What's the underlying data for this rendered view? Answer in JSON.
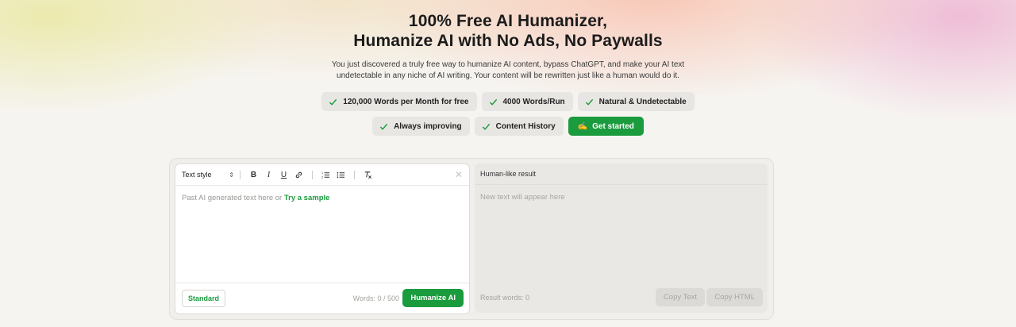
{
  "hero": {
    "title_line1": "100% Free AI Humanizer,",
    "title_line2": "Humanize AI with No Ads, No Paywalls",
    "subtitle": "You just discovered a truly free way to humanize AI content, bypass ChatGPT, and make your AI text undetectable in any niche of AI writing. Your content will be rewritten just like a human would do it."
  },
  "features": {
    "row1": [
      "120,000 Words per Month for free",
      "4000 Words/Run",
      "Natural & Undetectable"
    ],
    "row2": [
      "Always improving",
      "Content History"
    ],
    "cta_label": "Get started",
    "cta_emoji": "✍️"
  },
  "editor": {
    "text_style_label": "Text style",
    "text_style_arrow": "⇕",
    "placeholder_prefix": "Past AI generated text here or",
    "try_sample": "Try a sample",
    "mode_label": "Standard",
    "word_count": "Words: 0 / 500",
    "humanize_label": "Humanize AI",
    "toolbar_icons": [
      "bold-icon",
      "italic-icon",
      "underline-icon",
      "link-icon",
      "ordered-list-icon",
      "bullet-list-icon",
      "clear-format-icon",
      "close-icon"
    ]
  },
  "result": {
    "title": "Human-like result",
    "placeholder": "New text will appear here",
    "word_count": "Result words: 0",
    "copy_text": "Copy Text",
    "copy_html": "Copy HTML"
  },
  "colors": {
    "accent": "#1a9b3d",
    "background": "#f6f4f1"
  }
}
